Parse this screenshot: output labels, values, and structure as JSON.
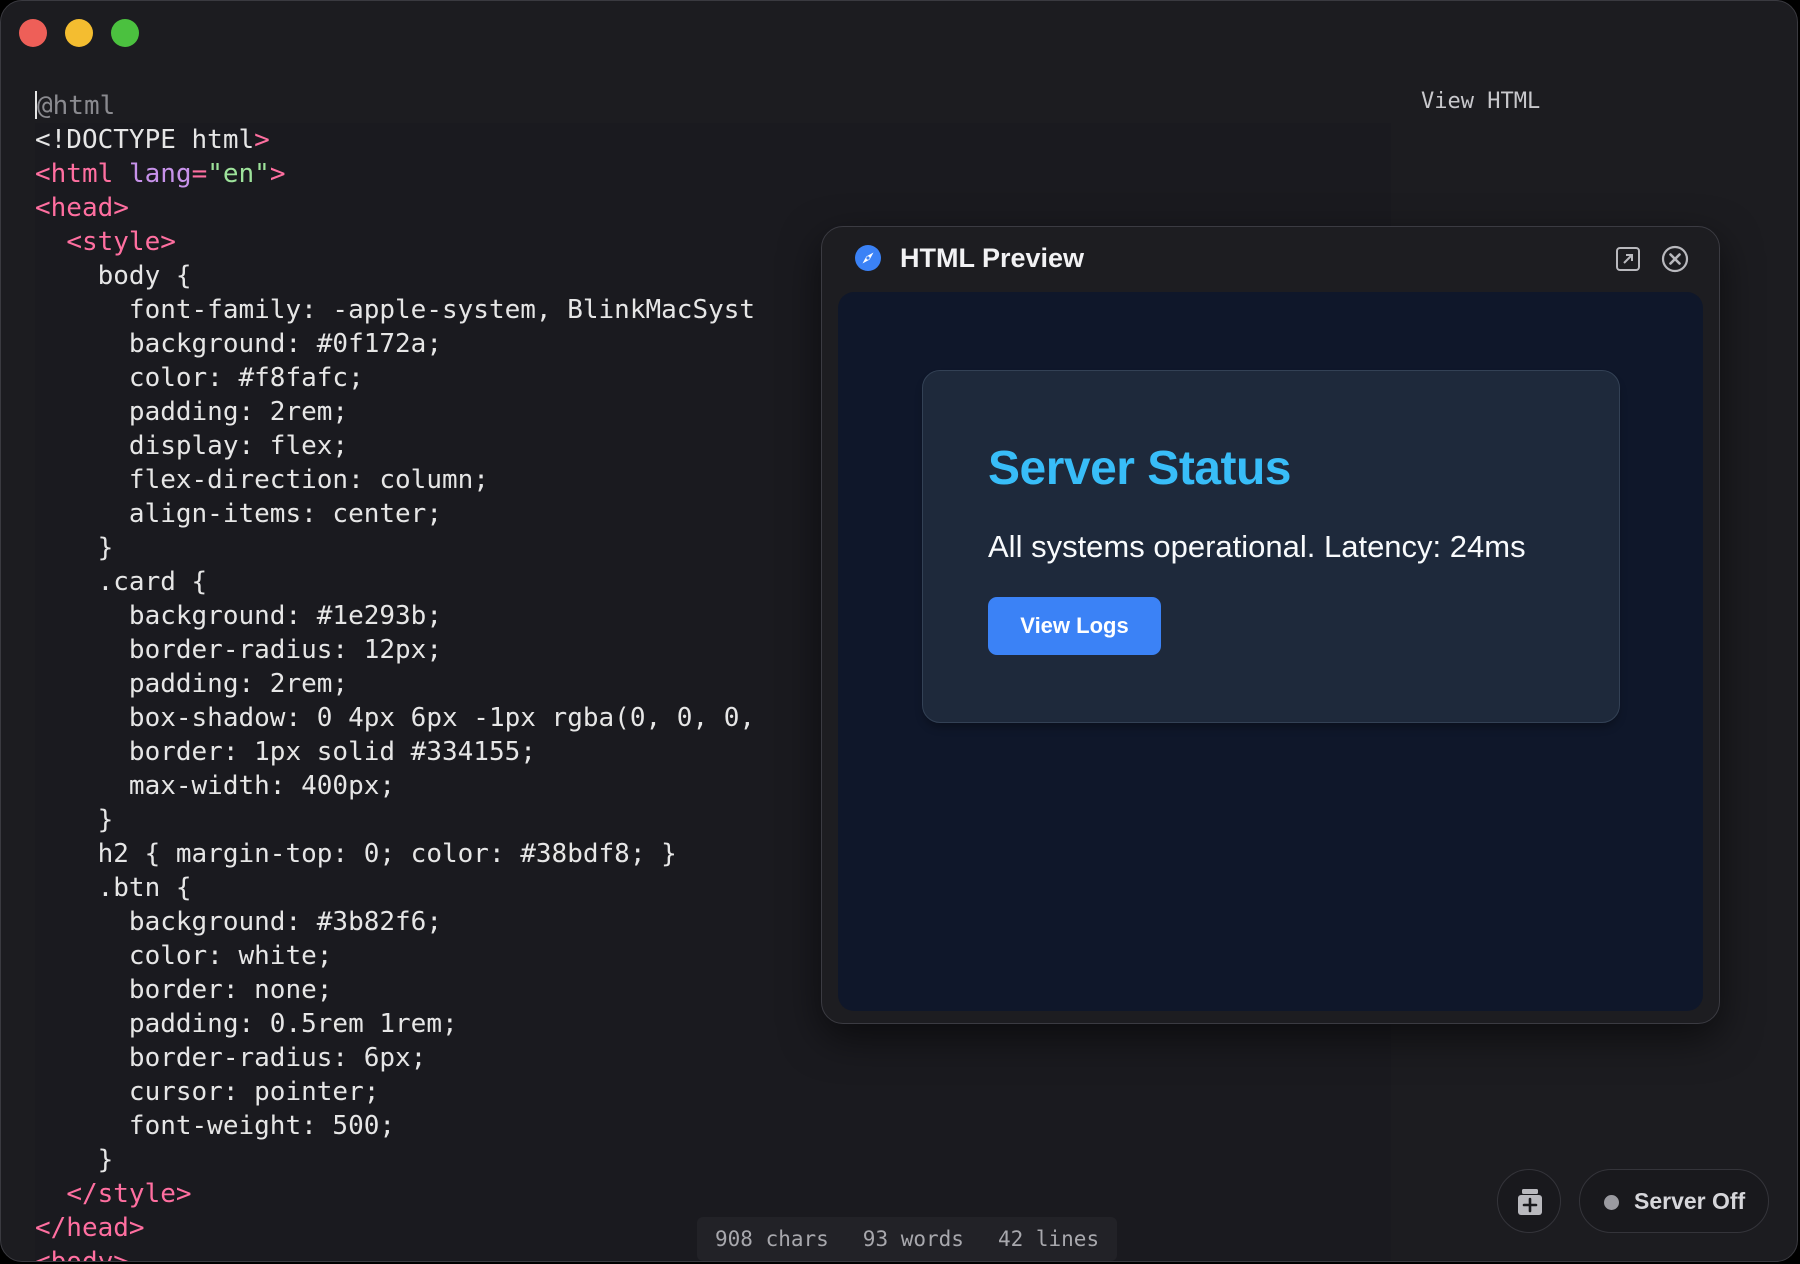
{
  "editor": {
    "lines": [
      "@html",
      "<!DOCTYPE html>",
      "<html lang=\"en\">",
      "<head>",
      "  <style>",
      "    body {",
      "      font-family: -apple-system, BlinkMacSyst",
      "      background: #0f172a;",
      "      color: #f8fafc;",
      "      padding: 2rem;",
      "      display: flex;",
      "      flex-direction: column;",
      "      align-items: center;",
      "    }",
      "    .card {",
      "      background: #1e293b;",
      "      border-radius: 12px;",
      "      padding: 2rem;",
      "      box-shadow: 0 4px 6px -1px rgba(0, 0, 0,",
      "      border: 1px solid #334155;",
      "      max-width: 400px;",
      "    }",
      "    h2 { margin-top: 0; color: #38bdf8; }",
      "    .btn {",
      "      background: #3b82f6;",
      "      color: white;",
      "      border: none;",
      "      padding: 0.5rem 1rem;",
      "      border-radius: 6px;",
      "      cursor: pointer;",
      "      font-weight: 500;",
      "    }",
      "  </style>",
      "</head>",
      "<body>"
    ]
  },
  "toolbar": {
    "view_html_label": "View HTML"
  },
  "preview": {
    "title": "HTML Preview",
    "icon": "compass-icon",
    "card": {
      "heading": "Server Status",
      "message": "All systems operational. Latency: 24ms",
      "button_label": "View Logs"
    }
  },
  "status_bar": {
    "chars": "908 chars",
    "words": "93 words",
    "lines": "42 lines"
  },
  "server": {
    "label": "Server Off",
    "status": "off"
  },
  "colors": {
    "accent": "#3b82f6",
    "heading": "#38bdf8",
    "preview_bg": "#0f172a",
    "card_bg": "#1e293b",
    "card_border": "#334155"
  }
}
